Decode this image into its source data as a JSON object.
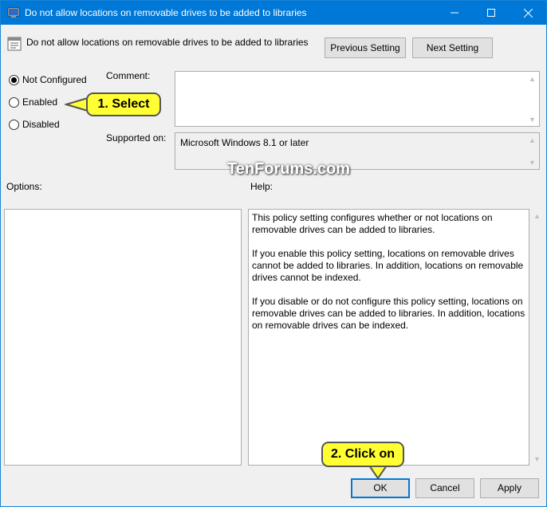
{
  "window": {
    "title": "Do not allow locations on removable drives to be added to libraries"
  },
  "header": {
    "title": "Do not allow locations on removable drives to be added to libraries",
    "previous_label": "Previous Setting",
    "next_label": "Next Setting"
  },
  "state": {
    "options": [
      {
        "label": "Not Configured",
        "selected": true
      },
      {
        "label": "Enabled",
        "selected": false
      },
      {
        "label": "Disabled",
        "selected": false
      }
    ]
  },
  "comment": {
    "label": "Comment:",
    "value": ""
  },
  "supported": {
    "label": "Supported on:",
    "value": "Microsoft Windows 8.1 or later"
  },
  "panels": {
    "options_label": "Options:",
    "help_label": "Help:"
  },
  "help": {
    "paragraphs": [
      "This policy setting configures whether or not locations on removable drives can be added to libraries.",
      "If you enable this policy setting, locations on removable drives cannot be added to libraries.  In addition, locations on removable drives cannot be indexed.",
      "If you disable or do not configure this policy setting, locations on removable drives can be added to libraries.  In addition, locations on removable drives can be indexed."
    ]
  },
  "footer": {
    "ok_label": "OK",
    "cancel_label": "Cancel",
    "apply_label": "Apply"
  },
  "annotations": {
    "watermark": "TenForums.com",
    "callout_select": "1. Select",
    "callout_click": "2. Click on"
  },
  "colors": {
    "titlebar": "#0078d7",
    "callout": "#ffff33",
    "default_button_border": "#0078d7"
  }
}
